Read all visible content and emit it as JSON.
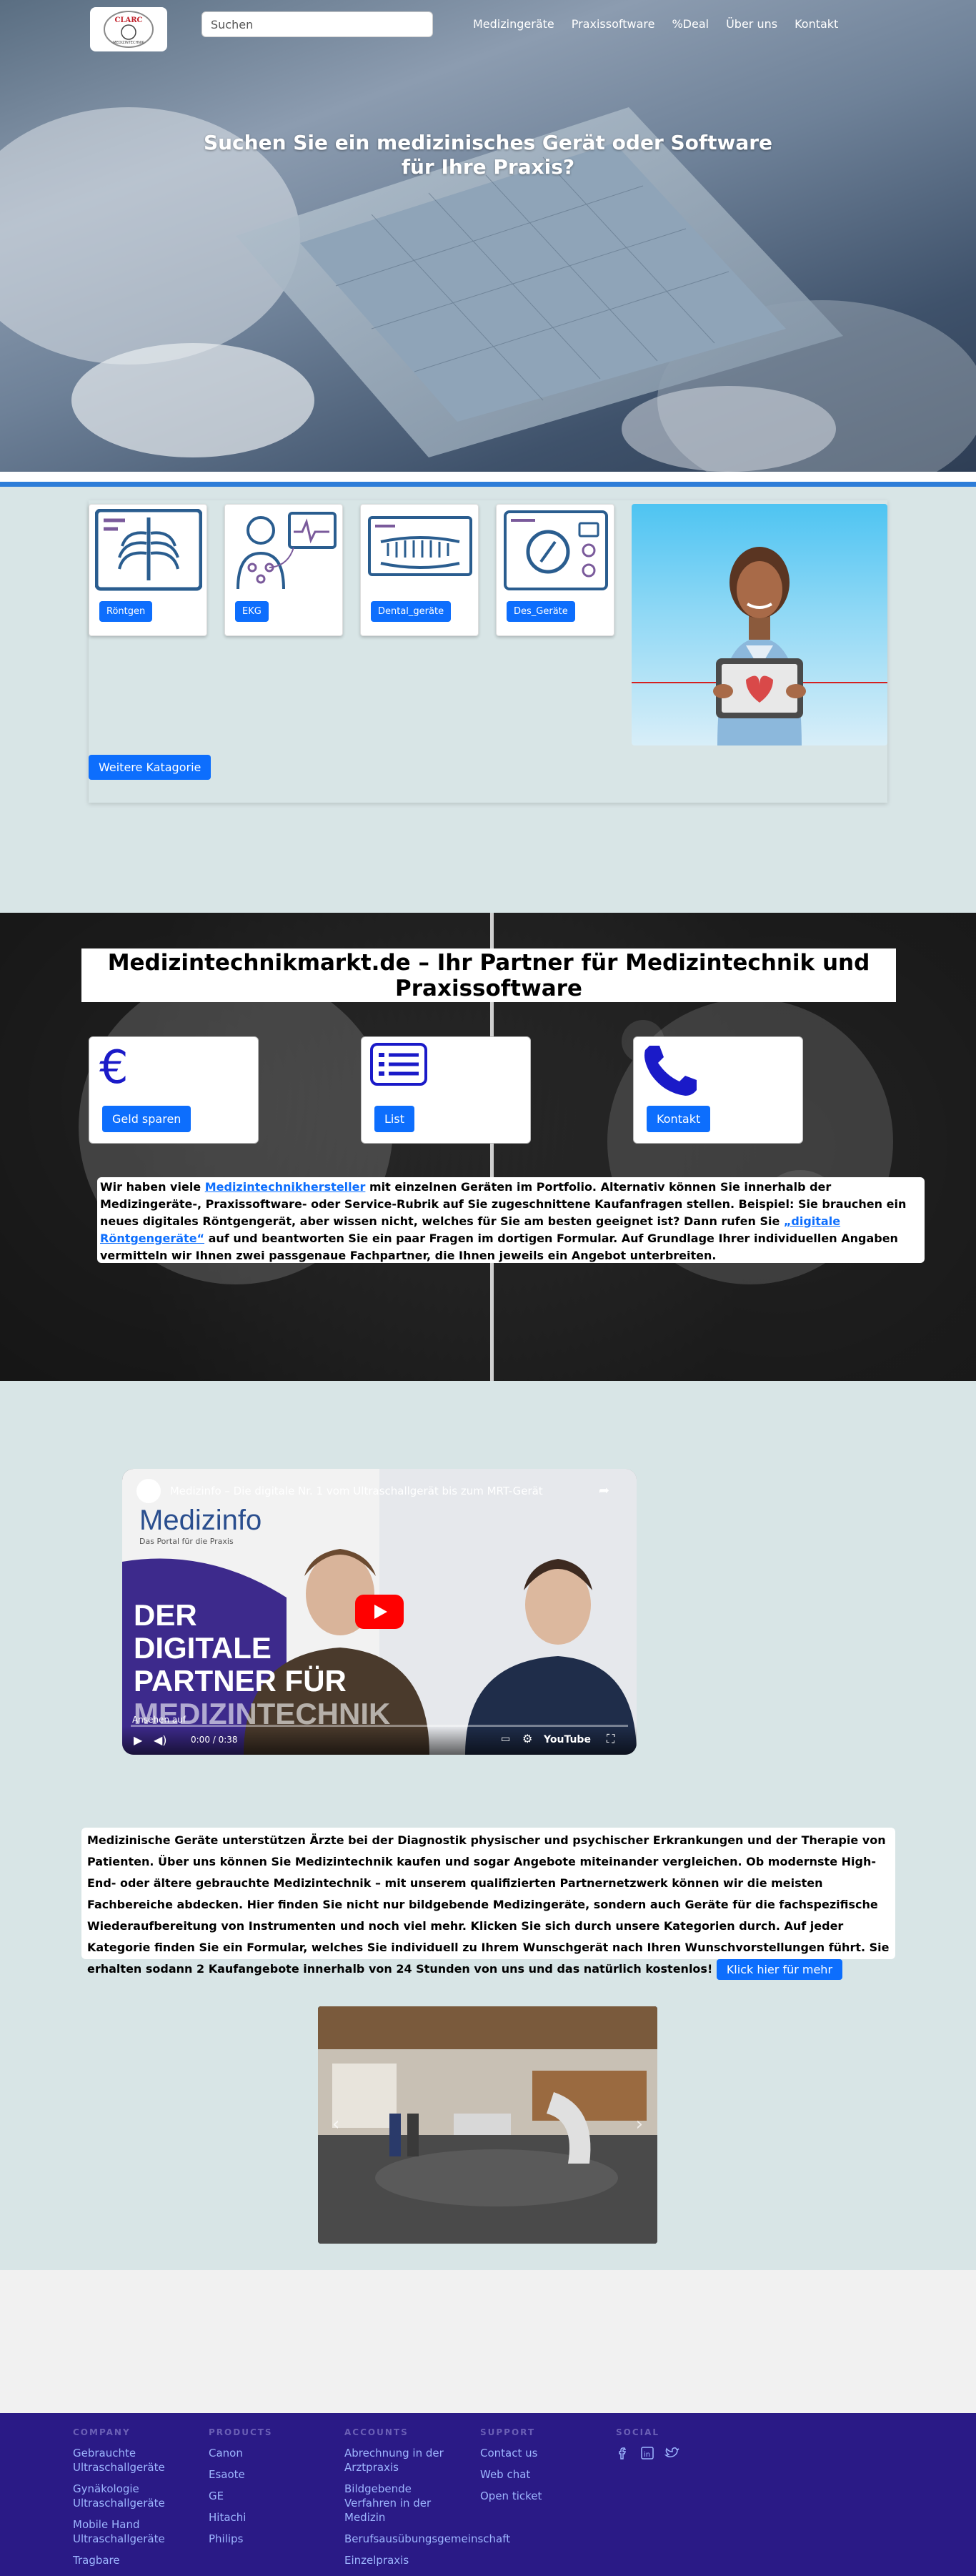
{
  "nav": {
    "search_placeholder": "Suchen",
    "menu": [
      "Medizingeräte",
      "Praxissoftware",
      "%Deal",
      "Über uns",
      "Kontakt"
    ]
  },
  "hero": {
    "title": "Suchen Sie ein medizinisches Gerät oder Software für Ihre Praxis?"
  },
  "categories": {
    "items": [
      "Röntgen",
      "EKG",
      "Dental_geräte",
      "Des_Geräte"
    ],
    "more": "Weitere Katagorie"
  },
  "partner": {
    "title": "Medizintechnikmarkt.de – Ihr Partner für Medizintechnik und Praxissoftware",
    "features": [
      "Geld sparen",
      "List",
      "Kontakt"
    ],
    "text_1": "Wir haben viele ",
    "link_1": "Medizintechnikhersteller",
    "text_2": " mit einzelnen Geräten im Portfolio. Alternativ können Sie innerhalb der Medizingeräte-, Praxissoftware- oder Service-Rubrik auf Sie zugeschnittene Kaufanfragen stellen. Beispiel: Sie brauchen ein neues digitales Röntgengerät, aber wissen nicht, welches für Sie am besten geeignet ist? Dann rufen Sie ",
    "link_2": "„digitale Röntgengeräte“",
    "text_3": " auf und beantworten Sie ein paar Fragen im dortigen Formular. Auf Grundlage Ihrer individuellen Angaben vermitteln wir Ihnen zwei passgenaue Fachpartner, die Ihnen jeweils ein Angebot unterbreiten."
  },
  "video": {
    "title": "Medizinfo – Die digitale Nr. 1 vom Ultraschallgerät bis zum MRT-Gerät",
    "brand": "Medizinfo",
    "brand_sub": "Das Portal für die Praxis",
    "headline": [
      "DER",
      "DIGITALE",
      "PARTNER FÜR",
      "MEDIZINTECHNIK"
    ],
    "watch_on": "Ansehen auf",
    "time": "0:00 / 0:38",
    "youtube": "YouTube"
  },
  "info": {
    "text": "Medizinische Geräte unterstützen Ärzte bei der Diagnostik physischer und psychischer Erkrankungen und der Therapie von Patienten. Über uns können Sie Medizintechnik kaufen und sogar Angebote miteinander vergleichen. Ob modernste High-End- oder ältere gebrauchte Medizintechnik – mit unserem qualifizierten Partnernetzwerk können wir die meisten Fachbereiche abdecken. Hier finden Sie nicht nur bildgebende Medizingeräte, sondern auch Geräte für die fachspezifische Wiederaufbereitung von Instrumenten und noch viel mehr. Klicken Sie sich durch unsere Kategorien durch. Auf jeder Kategorie finden Sie ein Formular, welches Sie individuell zu Ihrem Wunschgerät nach Ihren Wunschvorstellungen führt. Sie erhalten sodann 2 Kaufangebote innerhalb von 24 Stunden von uns und das natürlich kostenlos! ",
    "button": "Klick hier für mehr"
  },
  "footer": {
    "columns": [
      {
        "title": "COMPANY",
        "links": [
          "Gebrauchte Ultraschallgeräte",
          "Gynäkologie Ultraschallgeräte",
          "Mobile Hand Ultraschallgeräte",
          "Tragbare"
        ]
      },
      {
        "title": "PRODUCTS",
        "links": [
          "Canon",
          "Esaote",
          "GE",
          "Hitachi",
          "Philips"
        ]
      },
      {
        "title": "ACCOUNTS",
        "links": [
          "Abrechnung in der Arztpraxis",
          "Bildgebende Verfahren in der Medizin",
          "Berufsausübungsgemeinschaft",
          "Einzelpraxis"
        ]
      },
      {
        "title": "SUPPORT",
        "links": [
          "Contact us",
          "Web chat",
          "Open ticket"
        ]
      },
      {
        "title": "SOCIAL",
        "links": []
      }
    ]
  },
  "colors": {
    "primary": "#0d6efd",
    "section_bg": "#d8e5e6",
    "footer_bg": "#2a1a86",
    "accent_line": "#2d7dd8"
  }
}
